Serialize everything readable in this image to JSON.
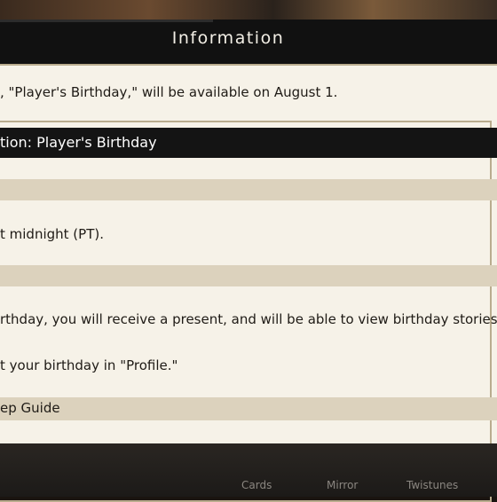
{
  "header": {
    "title": "Information"
  },
  "content": {
    "announcement": ", \"Player's Birthday,\" will be available on August 1.",
    "section_title": "tion: Player's Birthday",
    "schedule_text": "t midnight (PT).",
    "reward_text": "rthday, you will receive a present, and will be able to view birthday stories!",
    "profile_text": "t your birthday in \"Profile.\"",
    "guide_heading": "ep Guide"
  },
  "bottom_nav": {
    "cards": "Cards",
    "mirror": "Mirror",
    "twistunes": "Twistunes"
  },
  "colors": {
    "panel_bg": "#f6f2e8",
    "band": "#dcd2bd",
    "header_dark": "#141414",
    "frame": "#b9ac8e"
  }
}
